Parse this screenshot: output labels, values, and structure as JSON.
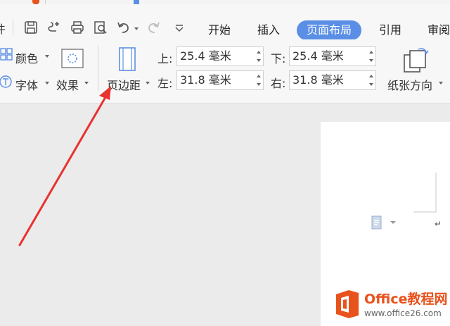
{
  "tabs": [
    {
      "id": "start",
      "label": "开始"
    },
    {
      "id": "insert",
      "label": "插入"
    },
    {
      "id": "layout",
      "label": "页面布局"
    },
    {
      "id": "reference",
      "label": "引用"
    },
    {
      "id": "review",
      "label": "审阅"
    }
  ],
  "active_tab": "页面布局",
  "left_cut_label": "件",
  "theme_group": {
    "color_label": "颜色",
    "font_label": "字体",
    "effect_label": "效果"
  },
  "margins": {
    "button_label": "页边距",
    "top": {
      "label": "上:",
      "value": "25.4 毫米"
    },
    "bottom": {
      "label": "下:",
      "value": "25.4 毫米"
    },
    "left": {
      "label": "左:",
      "value": "31.8 毫米"
    },
    "right": {
      "label": "右:",
      "value": "31.8 毫米"
    }
  },
  "orientation_label": "纸张方向",
  "watermark": {
    "brand": "Office教程网",
    "url": "www.office26.com"
  },
  "colors": {
    "accent": "#5b8fe6",
    "arrow": "#e8322e",
    "brand_orange": "#e8521c"
  }
}
